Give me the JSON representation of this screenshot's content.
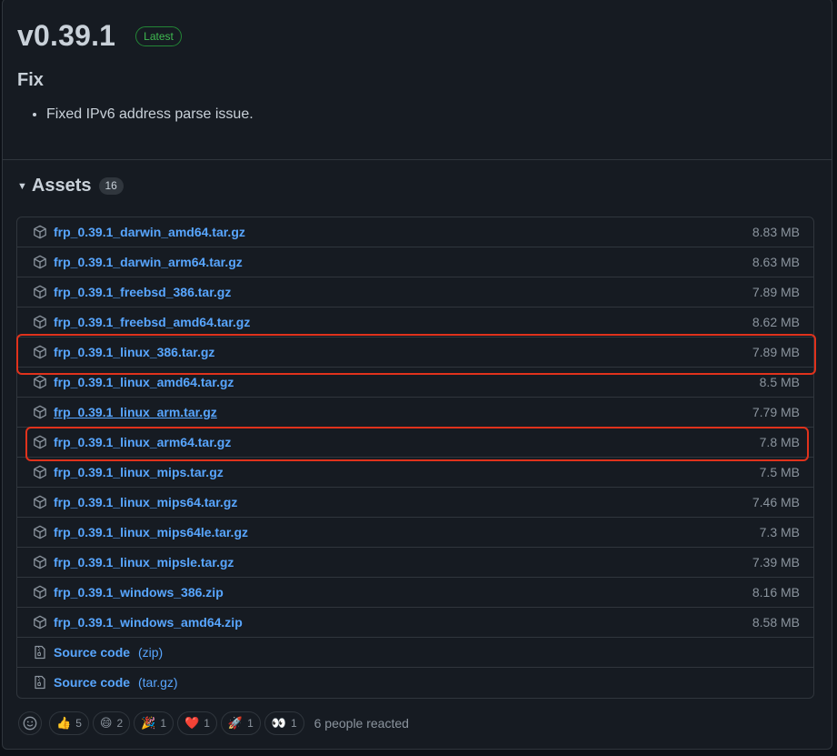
{
  "release": {
    "version": "v0.39.1",
    "badge": "Latest",
    "section_heading": "Fix",
    "notes": [
      "Fixed IPv6 address parse issue."
    ]
  },
  "assets": {
    "label": "Assets",
    "count": "16",
    "files": [
      {
        "name": "frp_0.39.1_darwin_amd64.tar.gz",
        "size": "8.83 MB"
      },
      {
        "name": "frp_0.39.1_darwin_arm64.tar.gz",
        "size": "8.63 MB"
      },
      {
        "name": "frp_0.39.1_freebsd_386.tar.gz",
        "size": "7.89 MB"
      },
      {
        "name": "frp_0.39.1_freebsd_amd64.tar.gz",
        "size": "8.62 MB"
      },
      {
        "name": "frp_0.39.1_linux_386.tar.gz",
        "size": "7.89 MB"
      },
      {
        "name": "frp_0.39.1_linux_amd64.tar.gz",
        "size": "8.5 MB"
      },
      {
        "name": "frp_0.39.1_linux_arm.tar.gz",
        "size": "7.79 MB"
      },
      {
        "name": "frp_0.39.1_linux_arm64.tar.gz",
        "size": "7.8 MB"
      },
      {
        "name": "frp_0.39.1_linux_mips.tar.gz",
        "size": "7.5 MB"
      },
      {
        "name": "frp_0.39.1_linux_mips64.tar.gz",
        "size": "7.46 MB"
      },
      {
        "name": "frp_0.39.1_linux_mips64le.tar.gz",
        "size": "7.3 MB"
      },
      {
        "name": "frp_0.39.1_linux_mipsle.tar.gz",
        "size": "7.39 MB"
      },
      {
        "name": "frp_0.39.1_windows_386.zip",
        "size": "8.16 MB"
      },
      {
        "name": "frp_0.39.1_windows_amd64.zip",
        "size": "8.58 MB"
      }
    ],
    "source": [
      {
        "label": "Source code",
        "ext": "(zip)"
      },
      {
        "label": "Source code",
        "ext": "(tar.gz)"
      }
    ]
  },
  "reactions": {
    "items": [
      {
        "icon": "thumbs-up",
        "emoji": "👍",
        "count": "5"
      },
      {
        "icon": "laugh",
        "emoji": "😄",
        "count": "2"
      },
      {
        "icon": "hooray",
        "emoji": "🎉",
        "count": "1"
      },
      {
        "icon": "heart",
        "emoji": "❤️",
        "count": "1"
      },
      {
        "icon": "rocket",
        "emoji": "🚀",
        "count": "1"
      },
      {
        "icon": "eyes",
        "emoji": "👀",
        "count": "1"
      }
    ],
    "summary": "6 people reacted"
  },
  "colors": {
    "link": "#58a6ff",
    "highlight": "#e0321c",
    "badge_green": "#3fb950"
  }
}
